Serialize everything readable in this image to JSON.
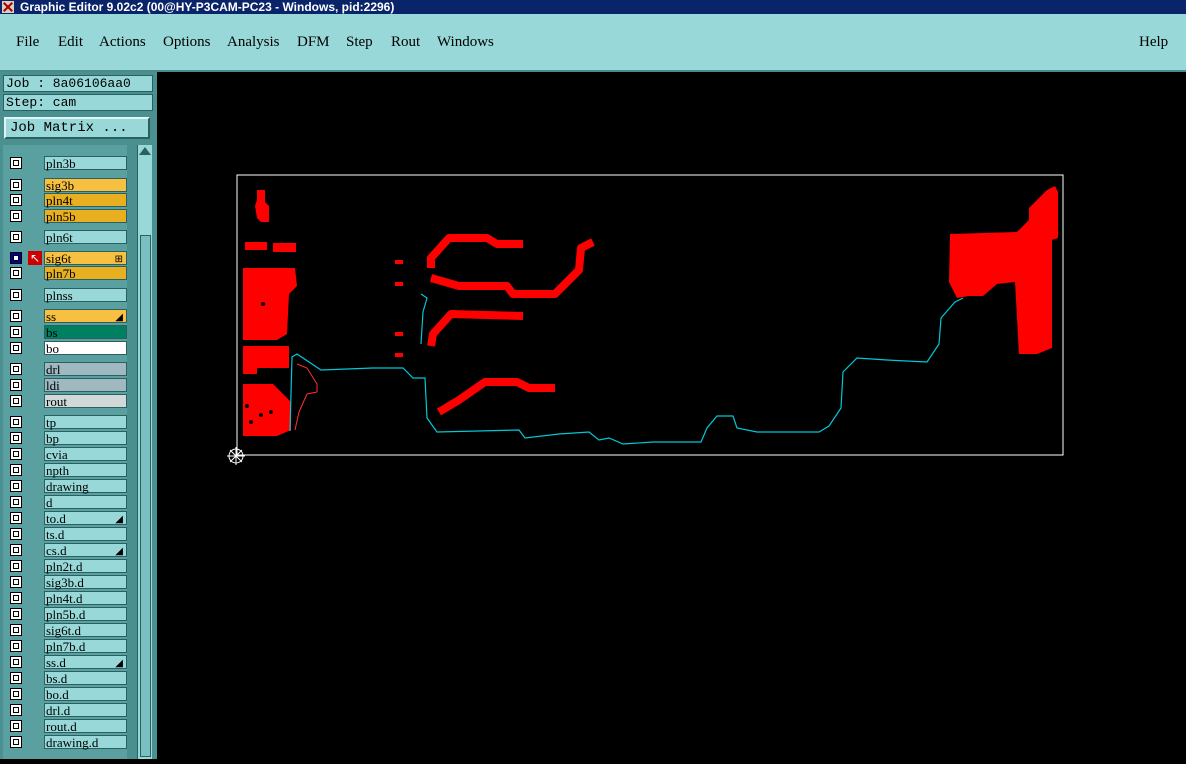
{
  "window": {
    "title": "Graphic Editor 9.02c2 (00@HY-P3CAM-PC23 - Windows, pid:2296)"
  },
  "menu": [
    {
      "label": "File",
      "underline": true
    },
    {
      "label": "Edit",
      "underline": true
    },
    {
      "label": "Actions",
      "underline": true
    },
    {
      "label": "Options",
      "underline": false
    },
    {
      "label": "Analysis",
      "underline": false
    },
    {
      "label": "DFM",
      "underline": false
    },
    {
      "label": "Step",
      "underline": true
    },
    {
      "label": "Rout",
      "underline": true
    },
    {
      "label": "Windows",
      "underline": true
    }
  ],
  "help_label": "Help",
  "job_label": "Job : 8a06106aa0",
  "step_label": "Step: cam",
  "job_matrix_label": "Job Matrix ...",
  "layers": [
    {
      "name": "pln3b",
      "bg": "#98d8d8"
    },
    {
      "name": "sig3b",
      "bg": "#f8c040"
    },
    {
      "name": "pln4t",
      "bg": "#e8b020"
    },
    {
      "name": "pln5b",
      "bg": "#e8b020"
    },
    {
      "name": "pln6t",
      "bg": "#98d8d8"
    },
    {
      "name": "sig6t",
      "bg": "#f8c040",
      "checked": true,
      "work": true,
      "mark": "⊞"
    },
    {
      "name": "pln7b",
      "bg": "#e8b020"
    },
    {
      "name": "plnss",
      "bg": "#98d8d8"
    },
    {
      "name": "ss",
      "bg": "#f8c040",
      "mark": "◢"
    },
    {
      "name": "bs",
      "bg": "#008060"
    },
    {
      "name": "bo",
      "bg": "#ffffff"
    },
    {
      "name": "drl",
      "bg": "#a0b8c0"
    },
    {
      "name": "ldi",
      "bg": "#a0b8c0"
    },
    {
      "name": "rout",
      "bg": "#d0d8d8"
    },
    {
      "name": "tp",
      "bg": "#98d8d8"
    },
    {
      "name": "bp",
      "bg": "#98d8d8"
    },
    {
      "name": "cvia",
      "bg": "#98d8d8"
    },
    {
      "name": "npth",
      "bg": "#98d8d8"
    },
    {
      "name": "drawing",
      "bg": "#98d8d8"
    },
    {
      "name": "d",
      "bg": "#98d8d8"
    },
    {
      "name": "to.d",
      "bg": "#98d8d8",
      "mark": "◢"
    },
    {
      "name": "ts.d",
      "bg": "#98d8d8"
    },
    {
      "name": "cs.d",
      "bg": "#98d8d8",
      "mark": "◢"
    },
    {
      "name": "pln2t.d",
      "bg": "#98d8d8"
    },
    {
      "name": "sig3b.d",
      "bg": "#98d8d8"
    },
    {
      "name": "pln4t.d",
      "bg": "#98d8d8"
    },
    {
      "name": "pln5b.d",
      "bg": "#98d8d8"
    },
    {
      "name": "sig6t.d",
      "bg": "#98d8d8"
    },
    {
      "name": "pln7b.d",
      "bg": "#98d8d8"
    },
    {
      "name": "ss.d",
      "bg": "#98d8d8",
      "mark": "◢"
    },
    {
      "name": "bs.d",
      "bg": "#98d8d8"
    },
    {
      "name": "bo.d",
      "bg": "#98d8d8"
    },
    {
      "name": "drl.d",
      "bg": "#98d8d8"
    },
    {
      "name": "rout.d",
      "bg": "#98d8d8"
    },
    {
      "name": "drawing.d",
      "bg": "#98d8d8"
    }
  ],
  "colors": {
    "panel": "#98d8d8",
    "titlebar": "#0a246a",
    "copper": "#ff0000",
    "rout": "#00c8d8",
    "profile": "#ffffff"
  }
}
